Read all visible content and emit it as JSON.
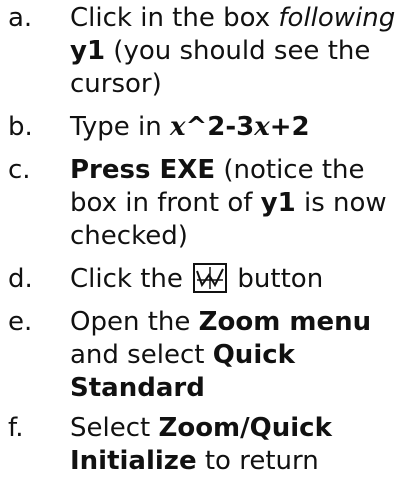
{
  "steps": [
    {
      "marker": "a.",
      "l1_pre": "Click in the box ",
      "l1_em": "following",
      "l2_strong": "y1",
      "l2_post": " (you should see the",
      "l3": "cursor)"
    },
    {
      "marker": "b.",
      "pre": "Type in ",
      "x1": "x",
      "op1": "^2-3",
      "x2": "x",
      "op2": "+2"
    },
    {
      "marker": "c.",
      "l1_strong": "Press EXE",
      "l1_post": " (notice the",
      "l2_pre": "box in front of ",
      "l2_strong": "y1",
      "l2_post": " is now",
      "l3": "checked)"
    },
    {
      "marker": "d.",
      "pre": "Click the ",
      "post": " button",
      "icon": "graph-icon"
    },
    {
      "marker": "e.",
      "l1_pre": "Open the ",
      "l1_strong": "Zoom menu",
      "l2_pre": "and select ",
      "l2_strong": "Quick",
      "l3_strong": "Standard"
    },
    {
      "marker": "f.",
      "l1_pre": "Select ",
      "l1_strong": "Zoom/Quick",
      "l2_strong": "Initialize",
      "l2_post": " to return"
    }
  ]
}
